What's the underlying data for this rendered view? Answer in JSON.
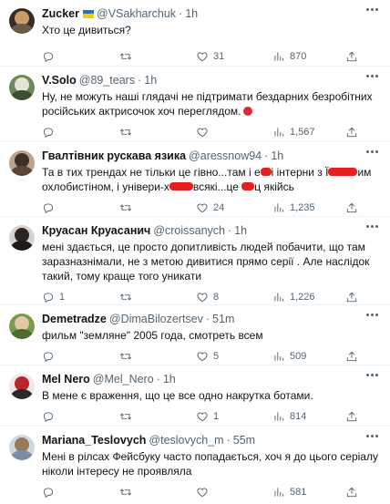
{
  "tweets": [
    {
      "name": "Zucker",
      "handle": "@VSakharchuk",
      "time": "1h",
      "flag": true,
      "text": "Хто це дивиться?",
      "replies": "",
      "retweets": "",
      "likes": "31",
      "views": "870"
    },
    {
      "name": "V.Solo",
      "handle": "@89_tears",
      "time": "1h",
      "text": "Ну, не можуть наші глядачі не підтримати бездарних безробітних російських актрисочок хоч переглядом.",
      "replies": "",
      "retweets": "",
      "likes": "",
      "views": "1,567"
    },
    {
      "name": "Гвалтівник рускава язика",
      "handle": "@aressnow94",
      "time": "1h",
      "text_parts": [
        "Та в тих трендах не тільки це гівно...там і е",
        "і інтерни з Ї",
        "им охлобистіном, і універи-х",
        "всякі...це ",
        "ц якійсь"
      ],
      "replies": "",
      "retweets": "",
      "likes": "24",
      "views": "1,235"
    },
    {
      "name": "Круасан Круасанич",
      "handle": "@croissanych",
      "time": "1h",
      "text": "мені здається, це просто допитливість людей побачити, що там заразназнімали, не з метою дивитися прямо серії . Але наслідок такий, тому краще того уникати",
      "replies": "1",
      "retweets": "",
      "likes": "8",
      "views": "1,226"
    },
    {
      "name": "Demetradze",
      "handle": "@DimaBilozertsev",
      "time": "51m",
      "text": "фильм \"земляне\" 2005 года, смотреть всем",
      "replies": "",
      "retweets": "",
      "likes": "5",
      "views": "509"
    },
    {
      "name": "Mel Nero",
      "handle": "@Mel_Nero",
      "time": "1h",
      "text": "В мене є враження, що це все одно накрутка ботами.",
      "replies": "",
      "retweets": "",
      "likes": "1",
      "views": "814"
    },
    {
      "name": "Mariana_Teslovych",
      "handle": "@teslovych_m",
      "time": "55m",
      "text": "Мені в рілсах Фейсбуку часто попадається, хоч я до цього серіалу ніколи інтересу не проявляла",
      "replies": "",
      "retweets": "",
      "likes": "",
      "views": "581"
    }
  ],
  "colors": {
    "muted": "#536471",
    "text": "#0f1419",
    "divider": "#eff3f4",
    "redaction": "#e3221f"
  }
}
